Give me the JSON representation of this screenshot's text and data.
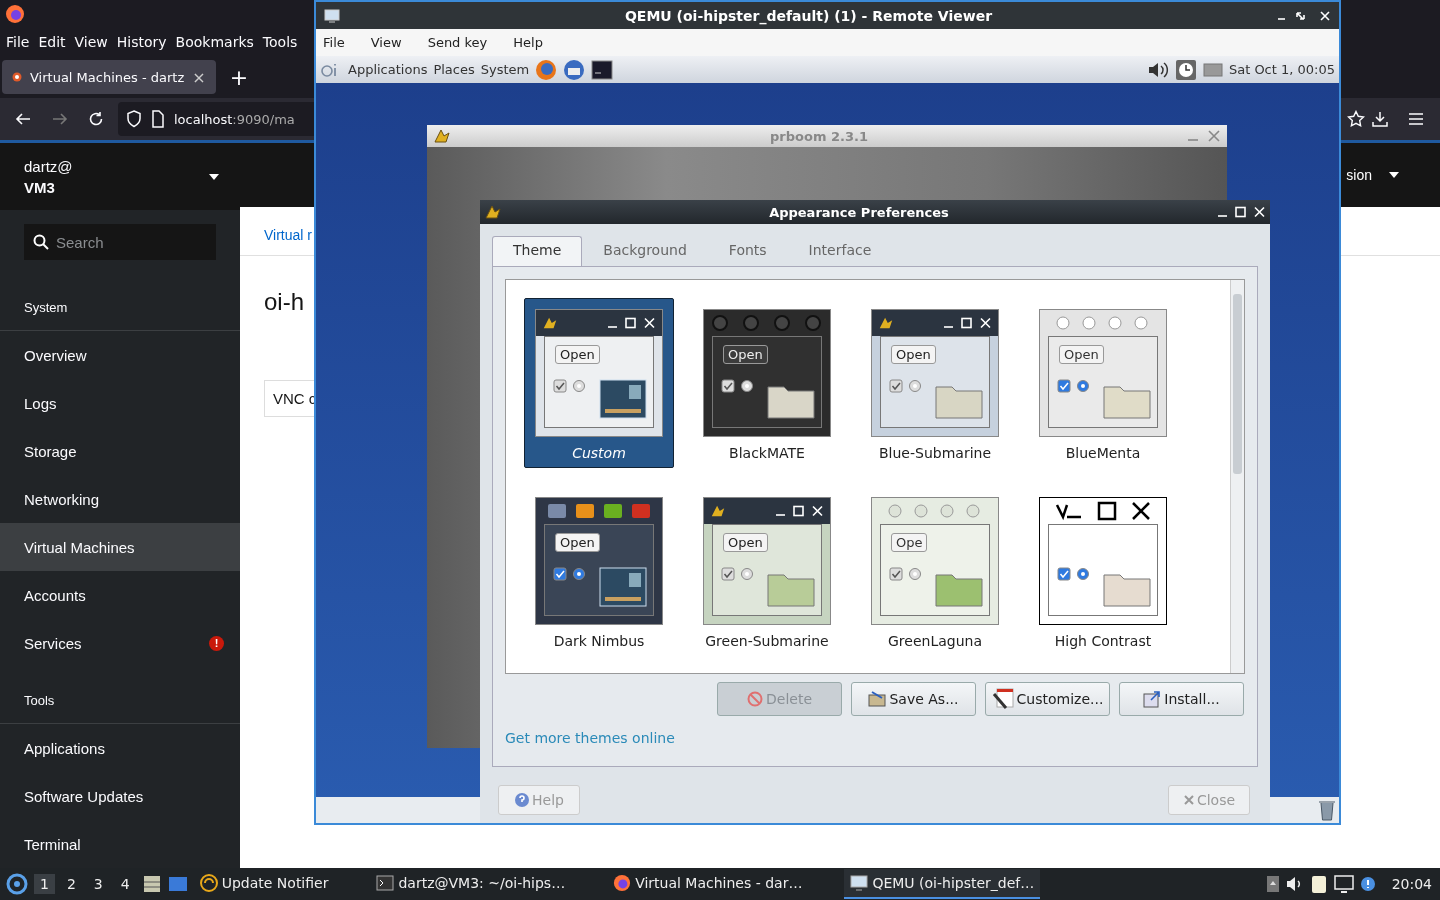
{
  "browser": {
    "menu": [
      "File",
      "Edit",
      "View",
      "History",
      "Bookmarks",
      "Tools"
    ],
    "tab": {
      "title": "Virtual Machines - dartz",
      "close": "×"
    },
    "new_tab": "+",
    "url": {
      "host": "localhost",
      "path": ":9090/ma"
    }
  },
  "cockpit": {
    "user": "dartz@",
    "host": "VM3",
    "search": {
      "placeholder": "Search"
    },
    "nav": [
      {
        "kind": "heading",
        "label": "System"
      },
      {
        "kind": "item",
        "label": "Overview",
        "selected": false
      },
      {
        "kind": "item",
        "label": "Logs",
        "selected": false
      },
      {
        "kind": "item",
        "label": "Storage",
        "selected": false
      },
      {
        "kind": "item",
        "label": "Networking",
        "selected": false
      },
      {
        "kind": "item",
        "label": "Virtual Machines",
        "selected": true
      },
      {
        "kind": "item",
        "label": "Accounts",
        "selected": false
      },
      {
        "kind": "item",
        "label": "Services",
        "selected": false,
        "badge": "!"
      },
      {
        "kind": "heading",
        "label": "Tools"
      },
      {
        "kind": "item",
        "label": "Applications",
        "selected": false
      },
      {
        "kind": "item",
        "label": "Software Updates",
        "selected": false
      },
      {
        "kind": "item",
        "label": "Terminal",
        "selected": false
      }
    ],
    "topbar_text": "sion",
    "breadcrumb": "Virtual r",
    "title": "oi-h",
    "card_text": "VNC c"
  },
  "qemu": {
    "title": "QEMU (oi-hipster_default) (1) - Remote Viewer",
    "menu": [
      "File",
      "View",
      "Send key",
      "Help"
    ],
    "panel": {
      "menus": [
        "Applications",
        "Places",
        "System"
      ],
      "clock": "Sat Oct  1, 00:05"
    }
  },
  "prboom": {
    "title": "prboom 2.3.1"
  },
  "dialog": {
    "title": "Appearance Preferences",
    "tabs": [
      {
        "label": "Theme",
        "selected": true
      },
      {
        "label": "Background",
        "selected": false
      },
      {
        "label": "Fonts",
        "selected": false
      },
      {
        "label": "Interface",
        "selected": false
      }
    ],
    "themes": [
      {
        "name": "Custom",
        "preview_label": "Open",
        "selected": true
      },
      {
        "name": "BlackMATE",
        "preview_label": "Open",
        "selected": false
      },
      {
        "name": "Blue-Submarine",
        "preview_label": "Open",
        "selected": false
      },
      {
        "name": "BlueMenta",
        "preview_label": "Open",
        "selected": false
      },
      {
        "name": "Dark Nimbus",
        "preview_label": "Open",
        "selected": false
      },
      {
        "name": "Green-Submarine",
        "preview_label": "Open",
        "selected": false
      },
      {
        "name": "GreenLaguna",
        "preview_label": "Ope",
        "selected": false
      },
      {
        "name": "High Contrast",
        "selected": false
      }
    ],
    "buttons": [
      {
        "kind": "delete",
        "label": "Delete",
        "disabled": true
      },
      {
        "kind": "save",
        "label": "Save As...",
        "disabled": false
      },
      {
        "kind": "customize",
        "label": "Customize...",
        "disabled": false
      },
      {
        "kind": "install",
        "label": "Install...",
        "disabled": false
      }
    ],
    "link": "Get more themes online",
    "footer_buttons": [
      {
        "kind": "help",
        "label": "Help"
      },
      {
        "kind": "close",
        "label": "Close"
      }
    ]
  },
  "taskbar": {
    "workspaces": [
      {
        "label": "1",
        "selected": true
      },
      {
        "label": "2",
        "selected": false
      },
      {
        "label": "3",
        "selected": false
      },
      {
        "label": "4",
        "selected": false
      }
    ],
    "tasks": [
      {
        "kind": "notifier",
        "label": "Update Notifier",
        "selected": false
      },
      {
        "kind": "terminal",
        "label": "dartz@VM3: ~/oi-hips…",
        "selected": false
      },
      {
        "kind": "firefox",
        "label": "Virtual Machines - dar…",
        "selected": false
      },
      {
        "kind": "monitor",
        "label": "QEMU (oi-hipster_def…",
        "selected": true
      }
    ],
    "clock": "20:04"
  }
}
